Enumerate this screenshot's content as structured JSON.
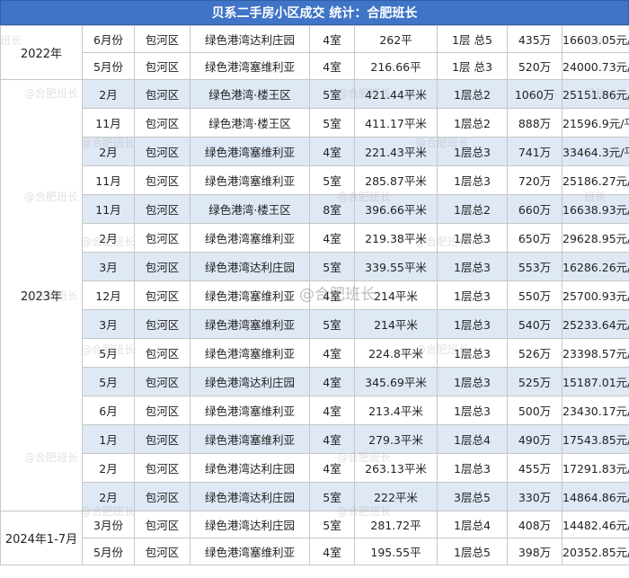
{
  "title": "贝系二手房小区成交  统计：合肥班长",
  "watermark": "@合肥班长",
  "watermark_center": "@合肥班长",
  "watermark_short": "班长",
  "groups": [
    {
      "year": "2022年",
      "rows": [
        {
          "month": "6月份",
          "district": "包河区",
          "community": "绿色港湾达利庄园",
          "rooms": "4室",
          "area": "262平",
          "floor": "1层 总5",
          "price": "435万",
          "unit_price": "16603.05元/平"
        },
        {
          "month": "5月份",
          "district": "包河区",
          "community": "绿色港湾塞维利亚",
          "rooms": "4室",
          "area": "216.66平",
          "floor": "1层 总3",
          "price": "520万",
          "unit_price": "24000.73元/平"
        }
      ]
    },
    {
      "year": "2023年",
      "rows": [
        {
          "month": "2月",
          "district": "包河区",
          "community": "绿色港湾·楼王区",
          "rooms": "5室",
          "area": "421.44平米",
          "floor": "1层总2",
          "price": "1060万",
          "unit_price": "25151.86元/平"
        },
        {
          "month": "11月",
          "district": "包河区",
          "community": "绿色港湾·楼王区",
          "rooms": "5室",
          "area": "411.17平米",
          "floor": "1层总2",
          "price": "888万",
          "unit_price": "21596.9元/平"
        },
        {
          "month": "2月",
          "district": "包河区",
          "community": "绿色港湾塞维利亚",
          "rooms": "4室",
          "area": "221.43平米",
          "floor": "1层总3",
          "price": "741万",
          "unit_price": "33464.3元/平"
        },
        {
          "month": "11月",
          "district": "包河区",
          "community": "绿色港湾塞维利亚",
          "rooms": "5室",
          "area": "285.87平米",
          "floor": "1层总3",
          "price": "720万",
          "unit_price": "25186.27元/平"
        },
        {
          "month": "11月",
          "district": "包河区",
          "community": "绿色港湾·楼王区",
          "rooms": "8室",
          "area": "396.66平米",
          "floor": "1层总2",
          "price": "660万",
          "unit_price": "16638.93元/平"
        },
        {
          "month": "2月",
          "district": "包河区",
          "community": "绿色港湾塞维利亚",
          "rooms": "4室",
          "area": "219.38平米",
          "floor": "1层总3",
          "price": "650万",
          "unit_price": "29628.95元/平"
        },
        {
          "month": "3月",
          "district": "包河区",
          "community": "绿色港湾达利庄园",
          "rooms": "5室",
          "area": "339.55平米",
          "floor": "1层总3",
          "price": "553万",
          "unit_price": "16286.26元/平"
        },
        {
          "month": "12月",
          "district": "包河区",
          "community": "绿色港湾塞维利亚",
          "rooms": "4室",
          "area": "214平米",
          "floor": "1层总3",
          "price": "550万",
          "unit_price": "25700.93元/平"
        },
        {
          "month": "3月",
          "district": "包河区",
          "community": "绿色港湾塞维利亚",
          "rooms": "5室",
          "area": "214平米",
          "floor": "1层总3",
          "price": "540万",
          "unit_price": "25233.64元/平"
        },
        {
          "month": "5月",
          "district": "包河区",
          "community": "绿色港湾塞维利亚",
          "rooms": "4室",
          "area": "224.8平米",
          "floor": "1层总3",
          "price": "526万",
          "unit_price": "23398.57元/平"
        },
        {
          "month": "5月",
          "district": "包河区",
          "community": "绿色港湾达利庄园",
          "rooms": "4室",
          "area": "345.69平米",
          "floor": "1层总3",
          "price": "525万",
          "unit_price": "15187.01元/平"
        },
        {
          "month": "6月",
          "district": "包河区",
          "community": "绿色港湾塞维利亚",
          "rooms": "4室",
          "area": "213.4平米",
          "floor": "1层总3",
          "price": "500万",
          "unit_price": "23430.17元/平"
        },
        {
          "month": "1月",
          "district": "包河区",
          "community": "绿色港湾塞维利亚",
          "rooms": "4室",
          "area": "279.3平米",
          "floor": "1层总4",
          "price": "490万",
          "unit_price": "17543.85元/平"
        },
        {
          "month": "2月",
          "district": "包河区",
          "community": "绿色港湾达利庄园",
          "rooms": "4室",
          "area": "263.13平米",
          "floor": "1层总3",
          "price": "455万",
          "unit_price": "17291.83元/平"
        },
        {
          "month": "2月",
          "district": "包河区",
          "community": "绿色港湾达利庄园",
          "rooms": "5室",
          "area": "222平米",
          "floor": "3层总5",
          "price": "330万",
          "unit_price": "14864.86元/平"
        }
      ]
    },
    {
      "year": "2024年1-7月",
      "rows": [
        {
          "month": "3月份",
          "district": "包河区",
          "community": "绿色港湾达利庄园",
          "rooms": "5室",
          "area": "281.72平",
          "floor": "1层总4",
          "price": "408万",
          "unit_price": "14482.46元/平"
        },
        {
          "month": "5月份",
          "district": "包河区",
          "community": "绿色港湾塞维利亚",
          "rooms": "4室",
          "area": "195.55平",
          "floor": "1层总5",
          "price": "398万",
          "unit_price": "20352.85元/平"
        }
      ]
    }
  ]
}
